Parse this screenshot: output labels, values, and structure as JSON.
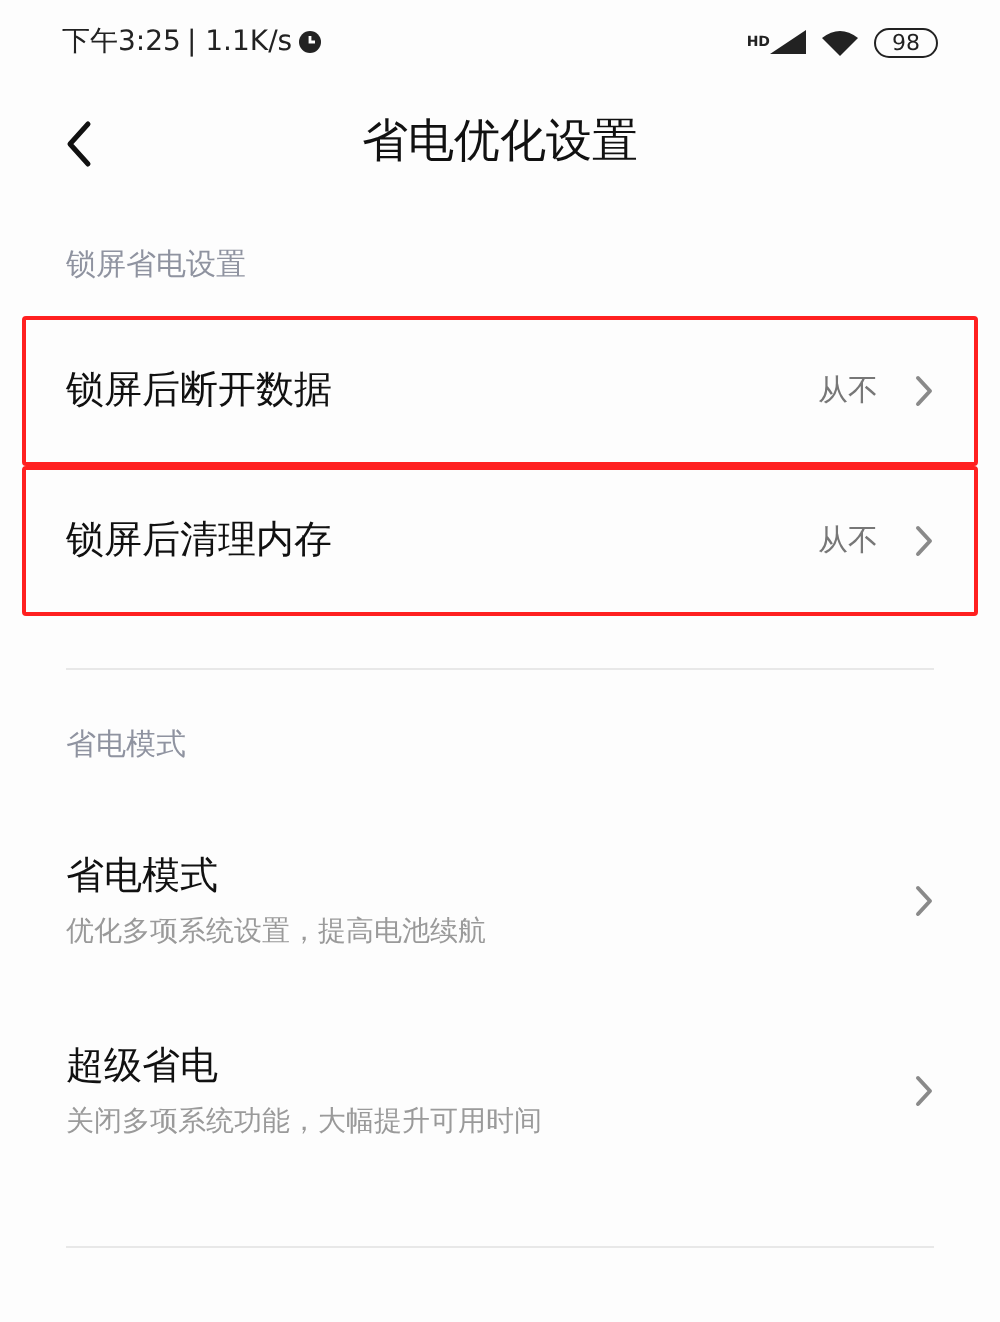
{
  "status_bar": {
    "time": "下午3:25",
    "speed": "| 1.1K/s",
    "network": "HD",
    "battery": "98"
  },
  "header": {
    "title": "省电优化设置"
  },
  "sections": [
    {
      "label": "锁屏省电设置",
      "items": [
        {
          "title": "锁屏后断开数据",
          "value": "从不",
          "highlighted": true
        },
        {
          "title": "锁屏后清理内存",
          "value": "从不",
          "highlighted": true
        }
      ]
    },
    {
      "label": "省电模式",
      "items": [
        {
          "title": "省电模式",
          "subtitle": "优化多项系统设置，提高电池续航",
          "highlighted": false
        },
        {
          "title": "超级省电",
          "subtitle": "关闭多项系统功能，大幅提升可用时间",
          "highlighted": false
        }
      ]
    }
  ]
}
